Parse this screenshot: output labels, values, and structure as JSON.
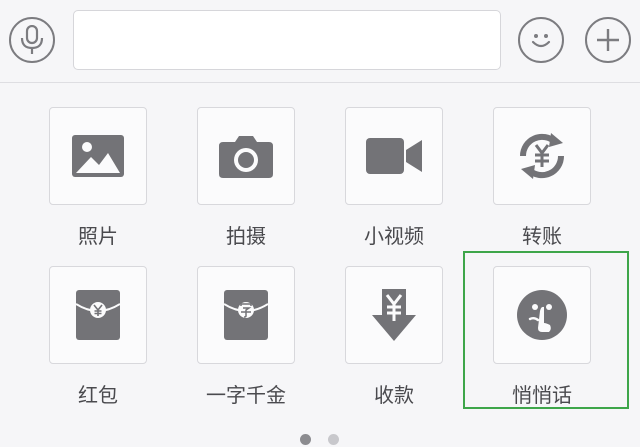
{
  "input_bar": {
    "voice_icon": "microphone-icon",
    "text_value": "",
    "emoji_icon": "smiley-icon",
    "more_icon": "plus-icon"
  },
  "panel": {
    "items": [
      {
        "label": "照片",
        "icon": "image-icon"
      },
      {
        "label": "拍摄",
        "icon": "camera-icon"
      },
      {
        "label": "小视频",
        "icon": "video-camera-icon"
      },
      {
        "label": "转账",
        "icon": "transfer-icon"
      },
      {
        "label": "红包",
        "icon": "red-packet-icon"
      },
      {
        "label": "一字千金",
        "icon": "word-red-packet-icon"
      },
      {
        "label": "收款",
        "icon": "receive-money-icon"
      },
      {
        "label": "悄悄话",
        "icon": "shush-face-icon"
      }
    ],
    "highlighted_item": "悄悄话"
  },
  "page_indicator": {
    "pages": 2,
    "current": 1
  },
  "colors": {
    "icon_gray": "#737377",
    "highlight": "#3ea64a",
    "dot_active": "#8c8c90",
    "dot_inactive": "#c8c8cc"
  }
}
